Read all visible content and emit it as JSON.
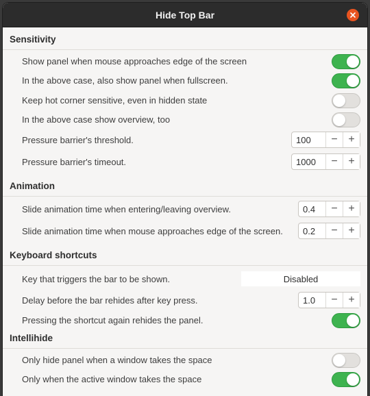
{
  "window": {
    "title": "Hide Top Bar"
  },
  "sections": {
    "sensitivity": "Sensitivity",
    "animation": "Animation",
    "keyboard": "Keyboard shortcuts",
    "intellihide": "Intellihide"
  },
  "settings": {
    "show_panel_edge": {
      "label": "Show panel when mouse approaches edge of the screen",
      "state": "on"
    },
    "show_fullscreen": {
      "label": "In the above case, also show panel when fullscreen.",
      "state": "on"
    },
    "hot_corner": {
      "label": "Keep hot corner sensitive, even in hidden state",
      "state": "off"
    },
    "show_overview": {
      "label": "In the above case show overview, too",
      "state": "off"
    },
    "pressure_threshold": {
      "label": "Pressure barrier's threshold.",
      "value": "100"
    },
    "pressure_timeout": {
      "label": "Pressure barrier's timeout.",
      "value": "1000"
    },
    "anim_overview": {
      "label": "Slide animation time when entering/leaving overview.",
      "value": "0.4"
    },
    "anim_edge": {
      "label": "Slide animation time when mouse approaches edge of the screen.",
      "value": "0.2"
    },
    "shortcut_key": {
      "label": "Key that triggers the bar to be shown.",
      "value": "Disabled"
    },
    "rehide_delay": {
      "label": "Delay before the bar rehides after key press.",
      "value": "1.0"
    },
    "shortcut_rehide": {
      "label": "Pressing the shortcut again rehides the panel.",
      "state": "on"
    },
    "hide_window_space": {
      "label": "Only hide panel when a window takes the space",
      "state": "off"
    },
    "active_window_space": {
      "label": "Only when the active window takes the space",
      "state": "on"
    }
  },
  "spin": {
    "minus": "−",
    "plus": "+"
  },
  "icons": {
    "close": "close-icon"
  },
  "colors": {
    "accent": "#e95420",
    "toggle_on": "#3eb34f",
    "titlebar": "#2c2c2c"
  }
}
